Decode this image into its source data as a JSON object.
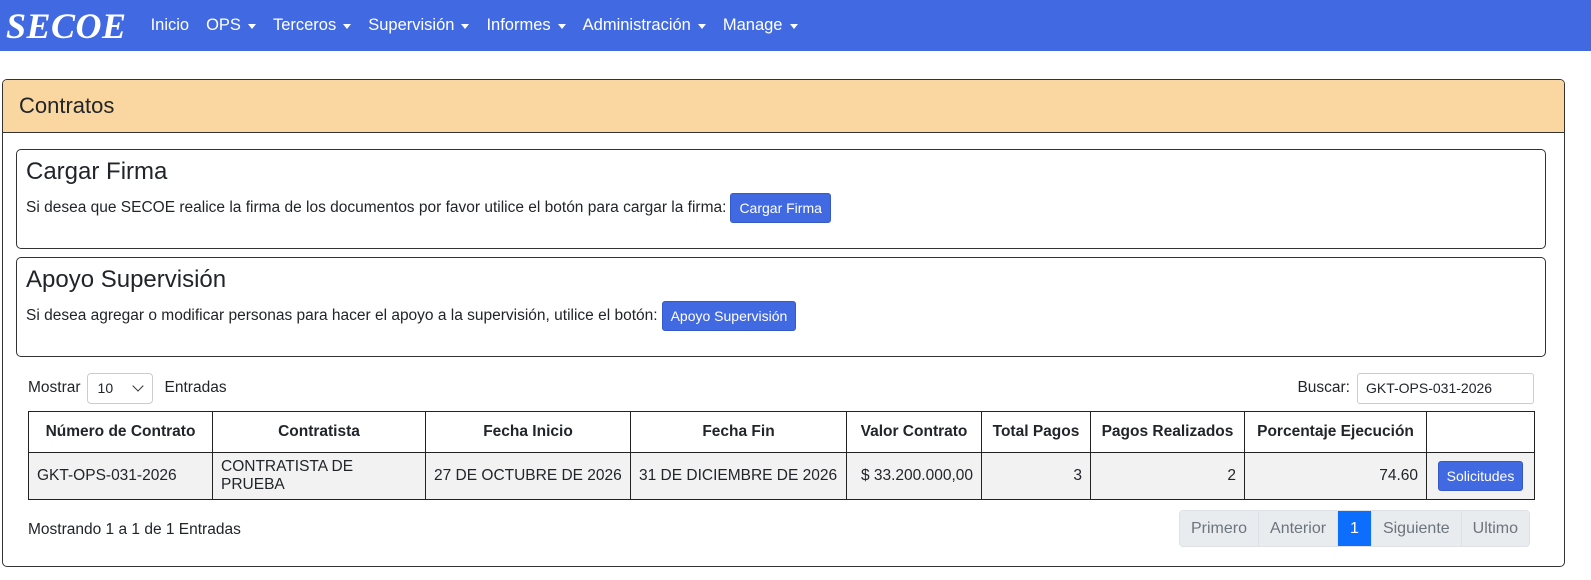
{
  "nav": {
    "brand": "SECOE",
    "items": [
      {
        "label": "Inicio",
        "dropdown": false
      },
      {
        "label": "OPS",
        "dropdown": true
      },
      {
        "label": "Terceros",
        "dropdown": true
      },
      {
        "label": "Supervisión",
        "dropdown": true
      },
      {
        "label": "Informes",
        "dropdown": true
      },
      {
        "label": "Administración",
        "dropdown": true
      },
      {
        "label": "Manage",
        "dropdown": true
      }
    ]
  },
  "card": {
    "title": "Contratos"
  },
  "firma": {
    "title": "Cargar Firma",
    "text": "Si desea que SECOE realice la firma de los documentos por favor utilice el botón para cargar la firma:",
    "button": "Cargar Firma"
  },
  "apoyo": {
    "title": "Apoyo Supervisión",
    "text": "Si desea agregar o modificar personas para hacer el apoyo a la supervisión, utilice el botón:",
    "button": "Apoyo Supervisión"
  },
  "table_controls": {
    "show_label": "Mostrar",
    "page_size": "10",
    "entries_label": "Entradas",
    "search_label": "Buscar:",
    "search_value": "GKT-OPS-031-2026"
  },
  "table": {
    "headers": [
      "Número de Contrato",
      "Contratista",
      "Fecha Inicio",
      "Fecha Fin",
      "Valor Contrato",
      "Total Pagos",
      "Pagos Realizados",
      "Porcentaje Ejecución",
      ""
    ],
    "rows": [
      {
        "numero": "GKT-OPS-031-2026",
        "contratista": "CONTRATISTA DE PRUEBA",
        "fecha_inicio": "27 DE OCTUBRE DE 2026",
        "fecha_fin": "31 DE DICIEMBRE DE 2026",
        "valor": "$ 33.200.000,00",
        "total_pagos": "3",
        "pagos_realizados": "2",
        "porcentaje": "74.60",
        "action": "Solicitudes"
      }
    ]
  },
  "footer": {
    "info": "Mostrando 1 a 1 de 1 Entradas",
    "pagination": [
      "Primero",
      "Anterior",
      "1",
      "Siguiente",
      "Ultimo"
    ],
    "active_page": "1"
  },
  "colors": {
    "navbar": "#4169e1",
    "header": "#fad7a0",
    "primary_button": "#4169e1",
    "active_page": "#0d6efd"
  }
}
